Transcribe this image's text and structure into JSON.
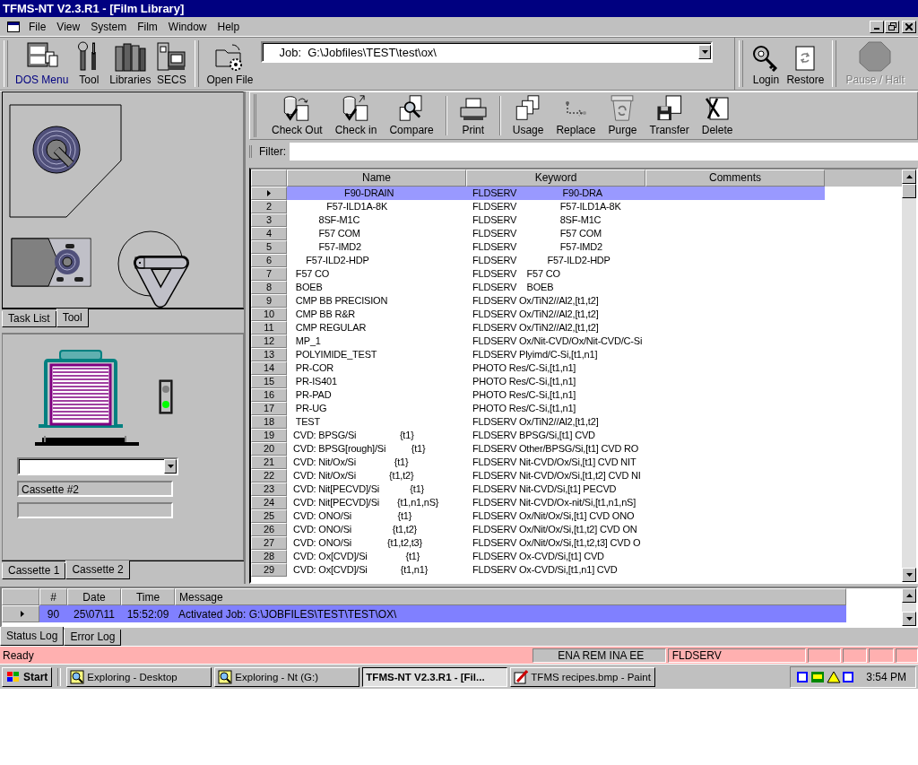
{
  "window": {
    "title": "TFMS-NT V2.3.R1 - [Film Library]"
  },
  "menu": [
    "File",
    "View",
    "System",
    "Film",
    "Window",
    "Help"
  ],
  "toolbar": {
    "groups": [
      {
        "buttons": [
          {
            "label": "DOS Menu",
            "highlighted": true,
            "disabled": false
          },
          {
            "label": "Tool",
            "highlighted": false,
            "disabled": false
          },
          {
            "label": "Libraries",
            "highlighted": false,
            "disabled": false
          },
          {
            "label": "SECS",
            "highlighted": false,
            "disabled": false
          }
        ]
      },
      {
        "buttons": [
          {
            "label": "Open File",
            "highlighted": false,
            "disabled": false
          }
        ]
      }
    ],
    "job_field": "Job:  G:\\Jobfiles\\TEST\\test\\ox\\",
    "right_groups": [
      {
        "buttons": [
          {
            "label": "Login",
            "highlighted": false,
            "disabled": false
          },
          {
            "label": "Restore",
            "highlighted": false,
            "disabled": false
          }
        ]
      },
      {
        "buttons": [
          {
            "label": "Pause / Halt",
            "highlighted": false,
            "disabled": true
          }
        ]
      }
    ]
  },
  "left_panel": {
    "tool_tabs": [
      {
        "label": "Task List",
        "selected": false
      },
      {
        "label": "Tool",
        "selected": true
      }
    ],
    "cassette_name": "Cassette #2",
    "cassette_tabs": [
      {
        "label": "Cassette 1",
        "selected": false
      },
      {
        "label": "Cassette 2",
        "selected": true
      }
    ]
  },
  "actions": [
    {
      "buttons": [
        "Check Out",
        "Check in",
        "Compare"
      ]
    },
    {
      "buttons": [
        "Print"
      ]
    },
    {
      "buttons": [
        "Usage",
        "Replace",
        "Purge",
        "Transfer",
        "Delete"
      ]
    }
  ],
  "filter": {
    "label": "Filter:"
  },
  "table": {
    "columns": [
      "Name",
      "Keyword",
      "Comments"
    ],
    "rows": [
      {
        "name": "                    F90-DRAIN",
        "keyword": "FLDSERV                  F90-DRA",
        "selected": true
      },
      {
        "number": "2",
        "name": "             F57-ILD1A-8K",
        "keyword": "FLDSERV                 F57-ILD1A-8K",
        "selected": false
      },
      {
        "number": "3",
        "name": "          8SF-M1C",
        "keyword": "FLDSERV                 8SF-M1C",
        "selected": false
      },
      {
        "number": "4",
        "name": "          F57 COM",
        "keyword": "FLDSERV                 F57 COM",
        "selected": false
      },
      {
        "number": "5",
        "name": "          F57-IMD2",
        "keyword": "FLDSERV                 F57-IMD2",
        "selected": false
      },
      {
        "number": "6",
        "name": "     F57-ILD2-HDP",
        "keyword": "FLDSERV            F57-ILD2-HDP",
        "selected": false
      },
      {
        "number": "7",
        "name": " F57 CO",
        "keyword": "FLDSERV    F57 CO",
        "selected": false
      },
      {
        "number": "8",
        "name": " BOEB",
        "keyword": "FLDSERV    BOEB",
        "selected": false
      },
      {
        "number": "9",
        "name": " CMP BB PRECISION",
        "keyword": "FLDSERV Ox/TiN2//Al2,[t1,t2]",
        "selected": false
      },
      {
        "number": "10",
        "name": " CMP BB R&R",
        "keyword": "FLDSERV Ox/TiN2//Al2,[t1,t2]",
        "selected": false
      },
      {
        "number": "11",
        "name": " CMP REGULAR",
        "keyword": "FLDSERV Ox/TiN2//Al2,[t1,t2]",
        "selected": false
      },
      {
        "number": "12",
        "name": " MP_1",
        "keyword": "FLDSERV Ox/Nit-CVD/Ox/Nit-CVD/C-Si",
        "selected": false
      },
      {
        "number": "13",
        "name": " POLYIMIDE_TEST",
        "keyword": "FLDSERV Plyimd/C-Si,[t1,n1]",
        "selected": false
      },
      {
        "number": "14",
        "name": " PR-COR",
        "keyword": "PHOTO Res/C-Si,[t1,n1]",
        "selected": false
      },
      {
        "number": "15",
        "name": " PR-IS401",
        "keyword": "PHOTO Res/C-Si,[t1,n1]",
        "selected": false
      },
      {
        "number": "16",
        "name": " PR-PAD",
        "keyword": "PHOTO Res/C-Si,[t1,n1]",
        "selected": false
      },
      {
        "number": "17",
        "name": " PR-UG",
        "keyword": "PHOTO Res/C-Si,[t1,n1]",
        "selected": false
      },
      {
        "number": "18",
        "name": " TEST",
        "keyword": "FLDSERV Ox/TiN2//Al2,[t1,t2]",
        "selected": false
      },
      {
        "number": "19",
        "name": "CVD: BPSG/Si                 {t1}",
        "keyword": "FLDSERV BPSG/Si,[t1] CVD",
        "selected": false
      },
      {
        "number": "20",
        "name": "CVD: BPSG[rough]/Si          {t1}",
        "keyword": "FLDSERV Other/BPSG/Si,[t1] CVD RO",
        "selected": false
      },
      {
        "number": "21",
        "name": "CVD: Nit/Ox/Si               {t1}",
        "keyword": "FLDSERV Nit-CVD/Ox/Si,[t1] CVD NIT",
        "selected": false
      },
      {
        "number": "22",
        "name": "CVD: Nit/Ox/Si             {t1,t2}",
        "keyword": "FLDSERV Nit-CVD/Ox/Si,[t1,t2] CVD NI",
        "selected": false
      },
      {
        "number": "23",
        "name": "CVD: Nit[PECVD]/Si            {t1}",
        "keyword": "FLDSERV Nit-CVD/Si,[t1] PECVD",
        "selected": false
      },
      {
        "number": "24",
        "name": "CVD: Nit[PECVD]/Si       {t1,n1,nS}",
        "keyword": "FLDSERV Nit-CVD/Ox-nit/Si,[t1,n1,nS]",
        "selected": false
      },
      {
        "number": "25",
        "name": "CVD: ONO/Si                  {t1}",
        "keyword": "FLDSERV Ox/Nit/Ox/Si,[t1] CVD ONO",
        "selected": false
      },
      {
        "number": "26",
        "name": "CVD: ONO/Si                {t1,t2}",
        "keyword": "FLDSERV Ox/Nit/Ox/Si,[t1,t2] CVD ON",
        "selected": false
      },
      {
        "number": "27",
        "name": "CVD: ONO/Si              {t1,t2,t3}",
        "keyword": "FLDSERV Ox/Nit/Ox/Si,[t1,t2,t3] CVD O",
        "selected": false
      },
      {
        "number": "28",
        "name": "CVD: Ox[CVD]/Si               {t1}",
        "keyword": "FLDSERV Ox-CVD/Si,[t1] CVD",
        "selected": false
      },
      {
        "number": "29",
        "name": "CVD: Ox[CVD]/Si             {t1,n1}",
        "keyword": "FLDSERV Ox-CVD/Si,[t1,n1] CVD",
        "selected": false
      }
    ]
  },
  "log": {
    "columns": [
      "#",
      "Date",
      "Time",
      "Message"
    ],
    "rows": [
      {
        "number": "90",
        "date": "25\\07\\11",
        "time": "15:52:09",
        "message": "Activated Job: G:\\JOBFILES\\TEST\\TEST\\OX\\",
        "selected": true
      }
    ],
    "tabs": [
      {
        "label": "Status Log",
        "selected": true
      },
      {
        "label": "Error Log",
        "selected": false
      }
    ]
  },
  "status_bar": {
    "text": "Ready",
    "mode": "ENA REM INA EE",
    "server": "FLDSERV"
  },
  "taskbar": {
    "start": "Start",
    "tasks": [
      {
        "label": "Exploring - Desktop",
        "selected": false
      },
      {
        "label": "Exploring - Nt (G:)",
        "selected": false
      },
      {
        "label": "TFMS-NT V2.3.R1 - [Fil...",
        "selected": true
      },
      {
        "label": "TFMS recipes.bmp - Paint",
        "selected": false
      }
    ],
    "clock": "3:54 PM"
  }
}
